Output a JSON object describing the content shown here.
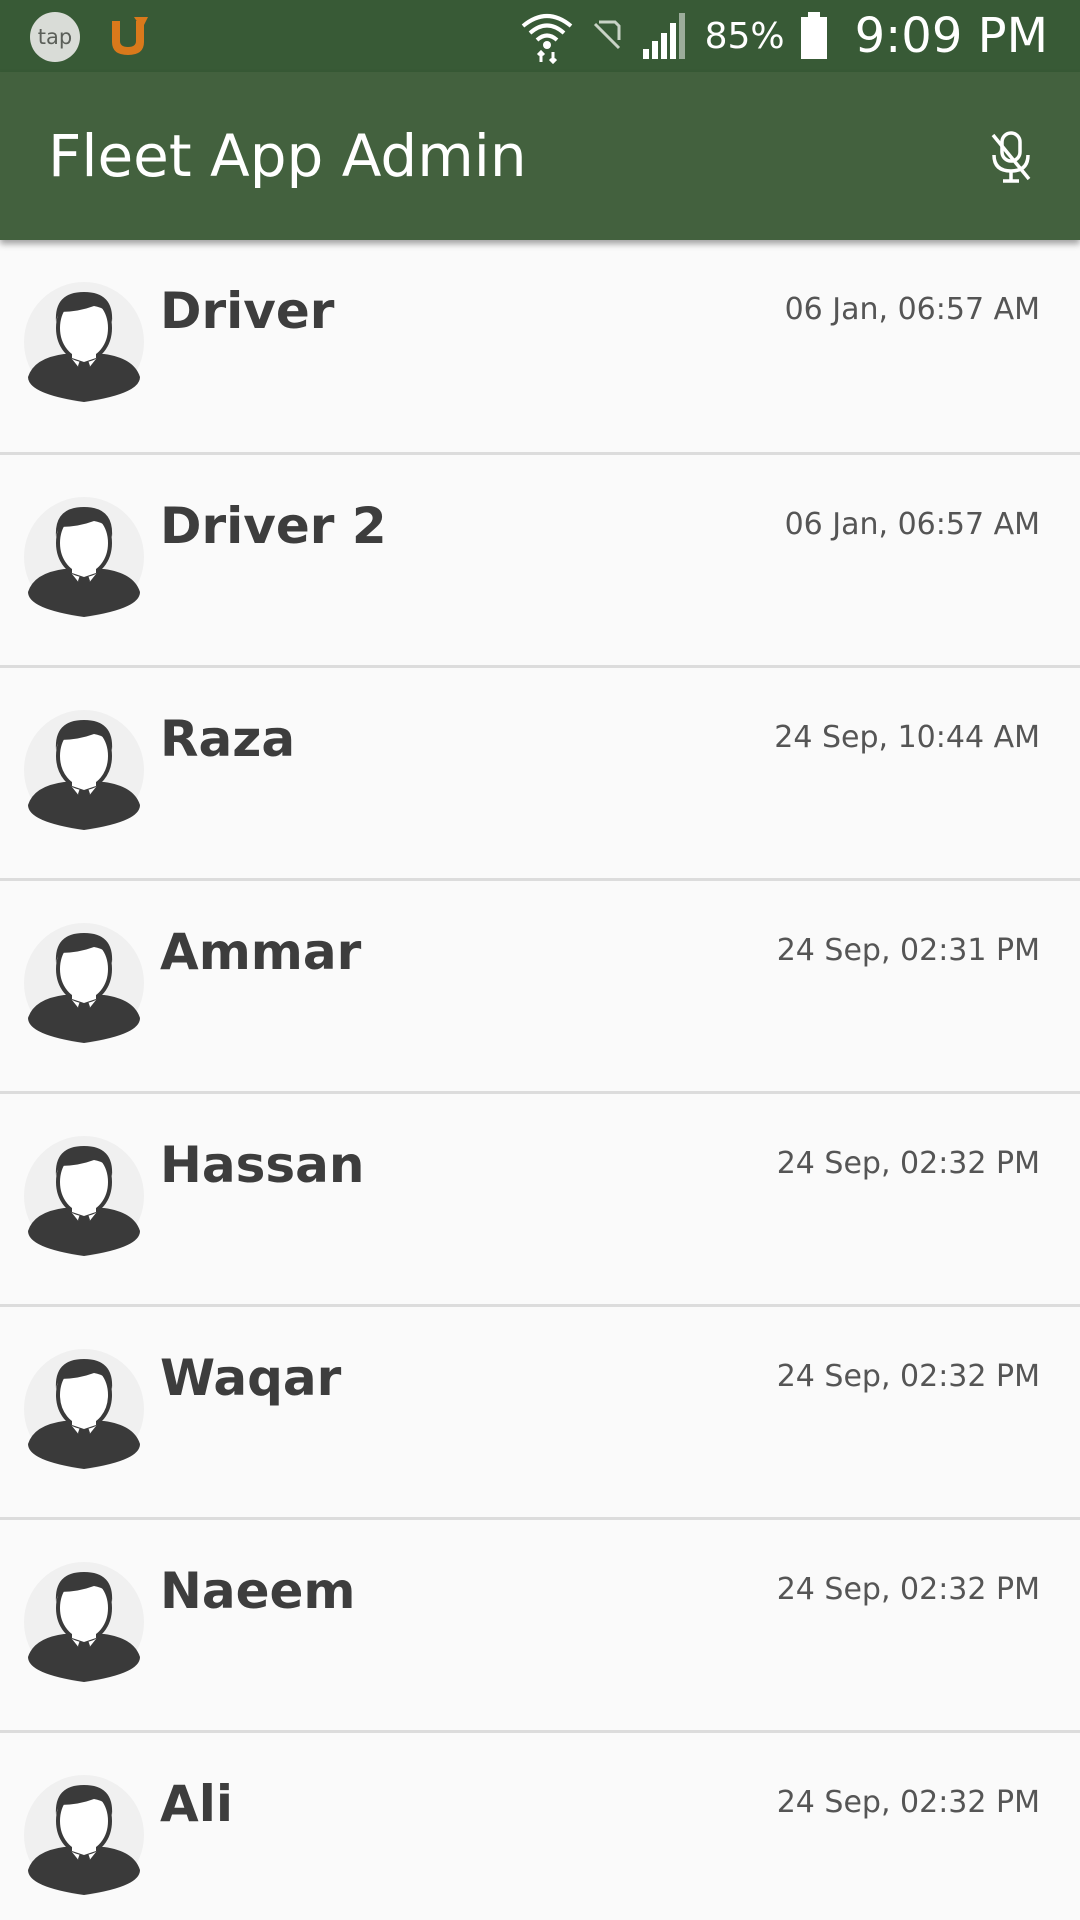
{
  "status_bar": {
    "notif_tap_label": "tap",
    "battery_percent": "85%",
    "time": "9:09 PM",
    "icons": [
      "tap-app-icon",
      "u-app-icon",
      "wifi-icon",
      "no-sim-icon",
      "signal-icon",
      "battery-icon"
    ]
  },
  "app_bar": {
    "title": "Fleet App Admin",
    "action_icon": "mic-off-icon",
    "color": "#43613e"
  },
  "drivers": [
    {
      "name": "Driver",
      "time": "06 Jan, 06:57 AM"
    },
    {
      "name": "Driver 2",
      "time": "06 Jan, 06:57 AM"
    },
    {
      "name": "Raza",
      "time": "24 Sep, 10:44 AM"
    },
    {
      "name": "Ammar",
      "time": "24 Sep, 02:31 PM"
    },
    {
      "name": "Hassan",
      "time": "24 Sep, 02:32 PM"
    },
    {
      "name": "Waqar",
      "time": "24 Sep, 02:32 PM"
    },
    {
      "name": "Naeem",
      "time": "24 Sep, 02:32 PM"
    },
    {
      "name": "Ali",
      "time": "24 Sep, 02:32 PM"
    }
  ]
}
